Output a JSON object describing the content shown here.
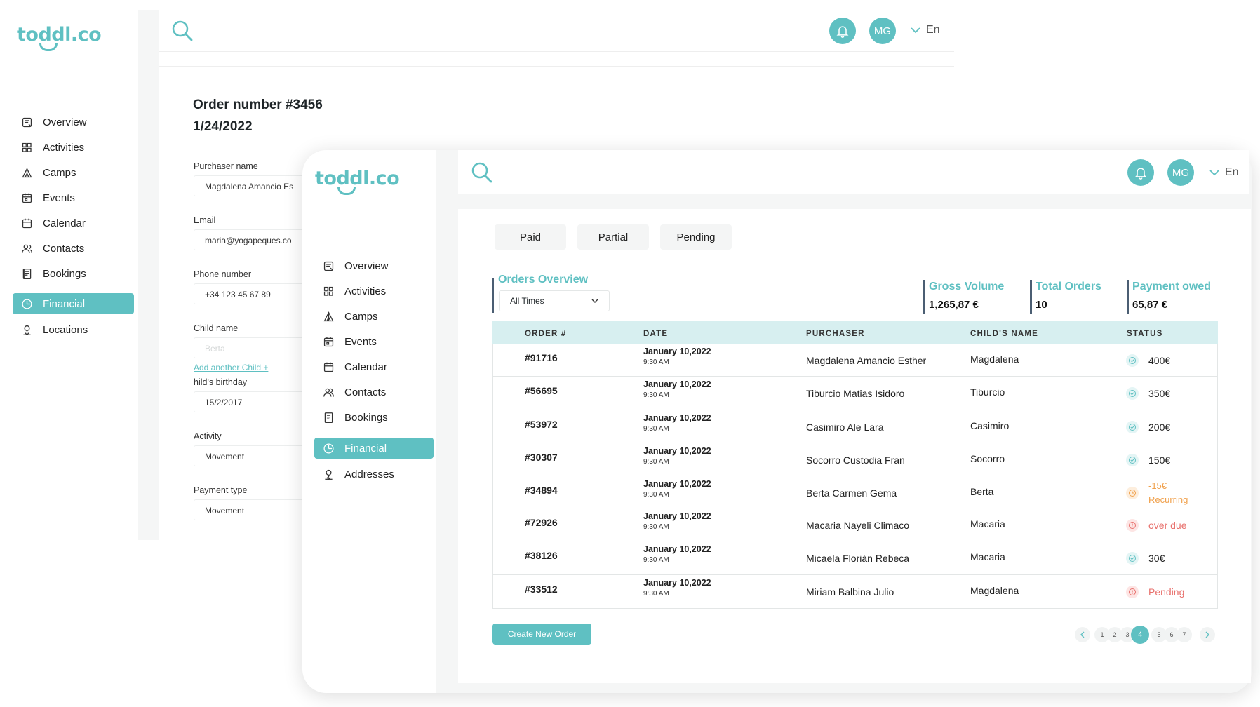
{
  "colors": {
    "accent": "#5fc0c2",
    "paid": "#5fc0c2",
    "recurring": "#f0a04b",
    "overdue": "#e8706c"
  },
  "back_window": {
    "logo": "toddl.co",
    "nav": [
      {
        "label": "Overview",
        "icon": "overview-icon"
      },
      {
        "label": "Activities",
        "icon": "grid-icon"
      },
      {
        "label": "Camps",
        "icon": "tent-icon"
      },
      {
        "label": "Events",
        "icon": "event-calendar-icon"
      },
      {
        "label": "Calendar",
        "icon": "calendar-icon"
      },
      {
        "label": "Contacts",
        "icon": "contacts-icon"
      },
      {
        "label": "Bookings",
        "icon": "bookings-icon"
      },
      {
        "label": "Financial",
        "icon": "financial-icon",
        "active": true
      },
      {
        "label": "Locations",
        "icon": "location-icon"
      }
    ],
    "header": {
      "avatar": "MG",
      "lang": "En"
    },
    "order": {
      "title": "Order number #3456",
      "date": "1/24/2022",
      "fields": [
        {
          "label": "Purchaser name",
          "value": "Magdalena Amancio Es"
        },
        {
          "label": "Email",
          "value": "maria@yogapeques.co"
        },
        {
          "label": "Phone number",
          "value": "+34 123 45 67 89"
        },
        {
          "label": "Child name",
          "value": "Berta"
        },
        {
          "label": "hild's birthday",
          "value": "15/2/2017"
        },
        {
          "label": "Activity",
          "value": "Movement"
        },
        {
          "label": "Payment type",
          "value": "Movement"
        }
      ],
      "add_child": "Add another Child +"
    }
  },
  "front_window": {
    "logo": "toddl.co",
    "nav": [
      {
        "label": "Overview",
        "icon": "overview-icon"
      },
      {
        "label": "Activities",
        "icon": "grid-icon"
      },
      {
        "label": "Camps",
        "icon": "tent-icon"
      },
      {
        "label": "Events",
        "icon": "event-calendar-icon"
      },
      {
        "label": "Calendar",
        "icon": "calendar-icon"
      },
      {
        "label": "Contacts",
        "icon": "contacts-icon"
      },
      {
        "label": "Bookings",
        "icon": "bookings-icon"
      },
      {
        "label": "Financial",
        "icon": "financial-icon",
        "active": true
      },
      {
        "label": "Addresses",
        "icon": "location-icon"
      }
    ],
    "header": {
      "avatar": "MG",
      "lang": "En"
    },
    "tabs": [
      "Paid",
      "Partial",
      "Pending"
    ],
    "overview": {
      "title": "Orders Overview",
      "filter": "All Times"
    },
    "metrics": [
      {
        "title": "Gross Volume",
        "value": "1,265,87 €"
      },
      {
        "title": "Total Orders",
        "value": "10"
      },
      {
        "title": "Payment owed",
        "value": "65,87 €"
      }
    ],
    "table": {
      "headers": [
        "ORDER #",
        "DATE",
        "PURCHASER",
        "CHILD'S NAME",
        "STATUS"
      ],
      "rows": [
        {
          "order": "#91716",
          "date": "January 10,2022",
          "time": "9:30 AM",
          "purchaser": "Magdalena Amancio Esther",
          "child": "Magdalena",
          "status": "400€",
          "status2": "",
          "kind": "paid"
        },
        {
          "order": "#56695",
          "date": "January 10,2022",
          "time": "9:30 AM",
          "purchaser": "Tiburcio Matias Isidoro",
          "child": "Tiburcio",
          "status": "350€",
          "status2": "",
          "kind": "paid"
        },
        {
          "order": "#53972",
          "date": "January 10,2022",
          "time": "9:30 AM",
          "purchaser": "Casimiro Ale Lara",
          "child": "Casimiro",
          "status": "200€",
          "status2": "",
          "kind": "paid"
        },
        {
          "order": "#30307",
          "date": "January 10,2022",
          "time": "9:30 AM",
          "purchaser": "Socorro Custodia Fran",
          "child": "Socorro",
          "status": "150€",
          "status2": "",
          "kind": "paid"
        },
        {
          "order": "#34894",
          "date": "January 10,2022",
          "time": "9:30 AM",
          "purchaser": "Berta Carmen Gema",
          "child": "Berta",
          "status": "-15€",
          "status2": "Recurring",
          "kind": "recurring"
        },
        {
          "order": "#72926",
          "date": "January 10,2022",
          "time": "9:30 AM",
          "purchaser": "Macaria Nayeli Climaco",
          "child": "Macaria",
          "status": "over due",
          "status2": "",
          "kind": "overdue"
        },
        {
          "order": "#38126",
          "date": "January 10,2022",
          "time": "9:30 AM",
          "purchaser": "Micaela Florián Rebeca",
          "child": "Macaria",
          "status": "30€",
          "status2": "",
          "kind": "paid"
        },
        {
          "order": "#33512",
          "date": "January 10,2022",
          "time": "9:30 AM",
          "purchaser": "Miriam Balbina Julio",
          "child": "Magdalena",
          "status": "Pending",
          "status2": "",
          "kind": "overdue"
        }
      ]
    },
    "create_button": "Create New Order",
    "pagination": {
      "pages": [
        "1",
        "2",
        "3",
        "4",
        "5",
        "6",
        "7"
      ],
      "current": "4"
    }
  }
}
